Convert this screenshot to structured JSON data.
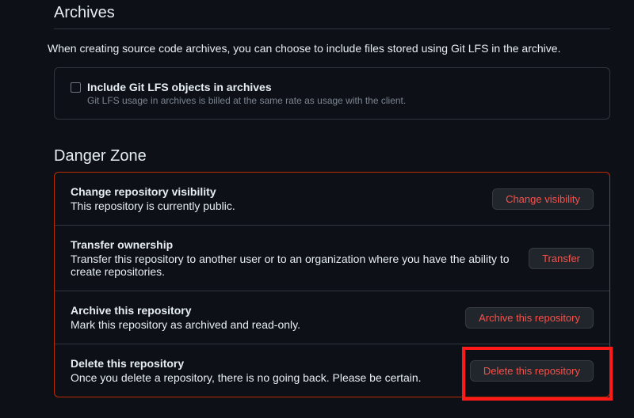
{
  "archives": {
    "header": "Archives",
    "description": "When creating source code archives, you can choose to include files stored using Git LFS in the archive.",
    "checkbox_label": "Include Git LFS objects in archives",
    "checkbox_desc": "Git LFS usage in archives is billed at the same rate as usage with the client."
  },
  "danger_zone": {
    "header": "Danger Zone",
    "items": [
      {
        "title": "Change repository visibility",
        "desc": "This repository is currently public.",
        "button": "Change visibility"
      },
      {
        "title": "Transfer ownership",
        "desc": "Transfer this repository to another user or to an organization where you have the ability to create repositories.",
        "button": "Transfer"
      },
      {
        "title": "Archive this repository",
        "desc": "Mark this repository as archived and read-only.",
        "button": "Archive this repository"
      },
      {
        "title": "Delete this repository",
        "desc": "Once you delete a repository, there is no going back. Please be certain.",
        "button": "Delete this repository"
      }
    ]
  }
}
